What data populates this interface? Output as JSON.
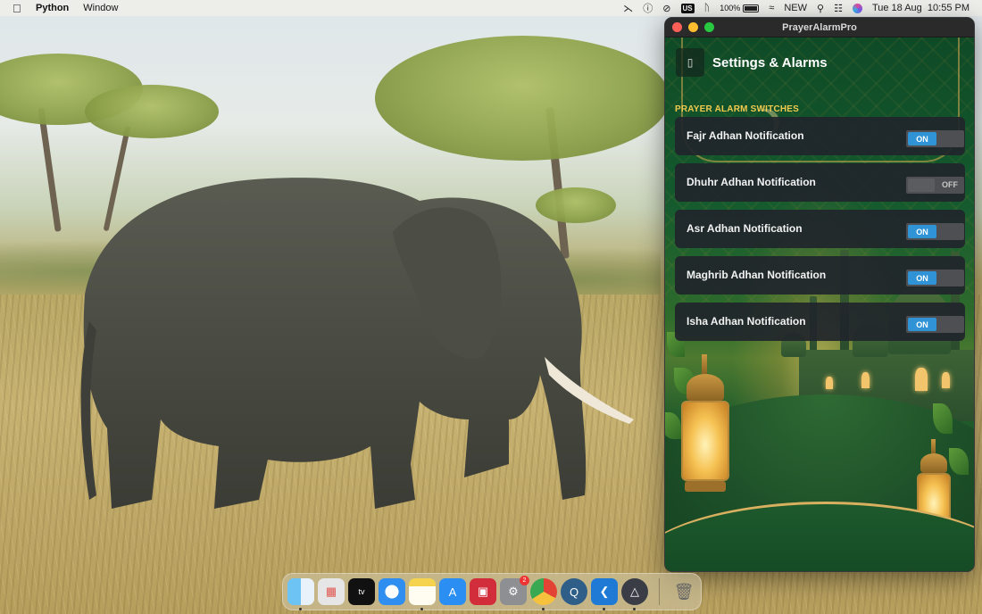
{
  "menubar": {
    "app_name": "Python",
    "menus": [
      "Window"
    ],
    "status": {
      "keyboard": "US",
      "battery": "100%",
      "input_source": "NEW",
      "datetime": "Tue 18 Aug  10:55 PM"
    }
  },
  "window": {
    "title": "PrayerAlarmPro",
    "back_icon": "▯",
    "page_title": "Settings & Alarms",
    "section_label": "PRAYER ALARM SWITCHES",
    "alarms": [
      {
        "label": "Fajr Adhan Notification",
        "state": "ON"
      },
      {
        "label": "Dhuhr Adhan Notification",
        "state": "OFF"
      },
      {
        "label": "Asr Adhan Notification",
        "state": "ON"
      },
      {
        "label": "Maghrib Adhan Notification",
        "state": "ON"
      },
      {
        "label": "Isha Adhan Notification",
        "state": "ON"
      }
    ]
  },
  "dock": {
    "items": [
      "finder",
      "launchpad",
      "apple-tv",
      "safari",
      "notes",
      "app-store",
      "photo-booth",
      "system-settings",
      "chrome",
      "quicktime",
      "vscode",
      "kite",
      "trash"
    ],
    "settings_badge": "2"
  },
  "colors": {
    "toggle_on": "#2f93d6",
    "section_label": "#f0c94f",
    "row_bg": "#21252b"
  }
}
